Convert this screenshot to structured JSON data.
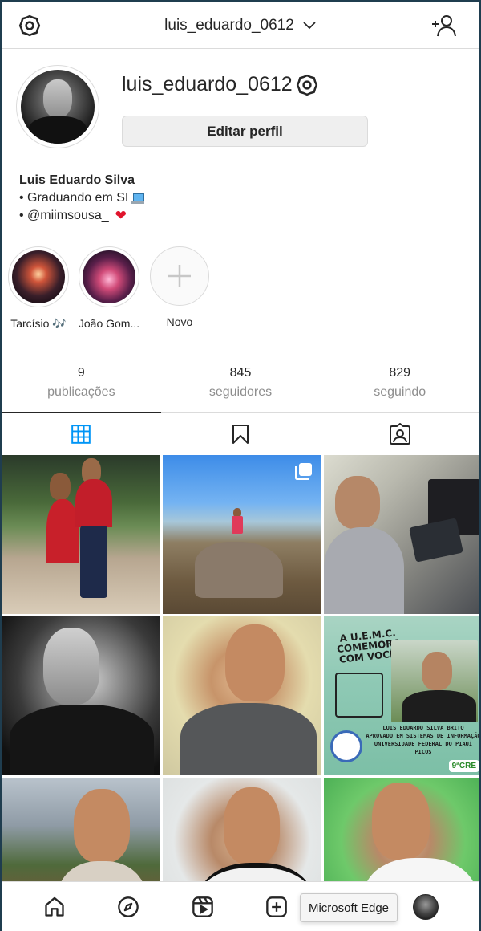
{
  "header": {
    "account_name": "luis_eduardo_0612",
    "settings_icon": "gear-icon",
    "switch_icon": "chevron-down-icon",
    "add_user_icon": "add-person-icon"
  },
  "profile": {
    "username": "luis_eduardo_0612",
    "edit_label": "Editar perfil",
    "full_name": "Luis Eduardo Silva",
    "bio_line_1": "• Graduando em SI",
    "bio_line_2": "• @miimsousa_"
  },
  "highlights": [
    {
      "label": "Tarcísio 🎶"
    },
    {
      "label": "João Gom..."
    },
    {
      "label": "Novo"
    }
  ],
  "stats": [
    {
      "value": "9",
      "label": "publicações"
    },
    {
      "value": "845",
      "label": "seguidores"
    },
    {
      "value": "829",
      "label": "seguindo"
    }
  ],
  "tabs": [
    {
      "icon": "grid-icon",
      "active": true
    },
    {
      "icon": "bookmark-icon",
      "active": false
    },
    {
      "icon": "tagged-user-icon",
      "active": false
    }
  ],
  "grid_posts": {
    "post6": {
      "headline": "A U.E.M.C. COMEMORA COM VOCÊ!",
      "caption_1": "LUIS EDUARDO SILVA BRITO",
      "caption_2": "APROVADO EM SISTEMAS DE INFORMAÇÃO",
      "caption_3": "UNIVERSIDADE FEDERAL DO PIAUÍ",
      "caption_4": "PICOS",
      "badge": "9ªCRE"
    }
  },
  "bottom_nav": [
    "home-icon",
    "explore-icon",
    "reels-icon",
    "new-post-icon",
    "profile-avatar"
  ],
  "tooltip": "Microsoft Edge",
  "colors": {
    "accent": "#0095f6",
    "heart": "#e0142c",
    "text": "#262626",
    "muted": "#8e8e8e",
    "border": "#dbdbdb"
  }
}
